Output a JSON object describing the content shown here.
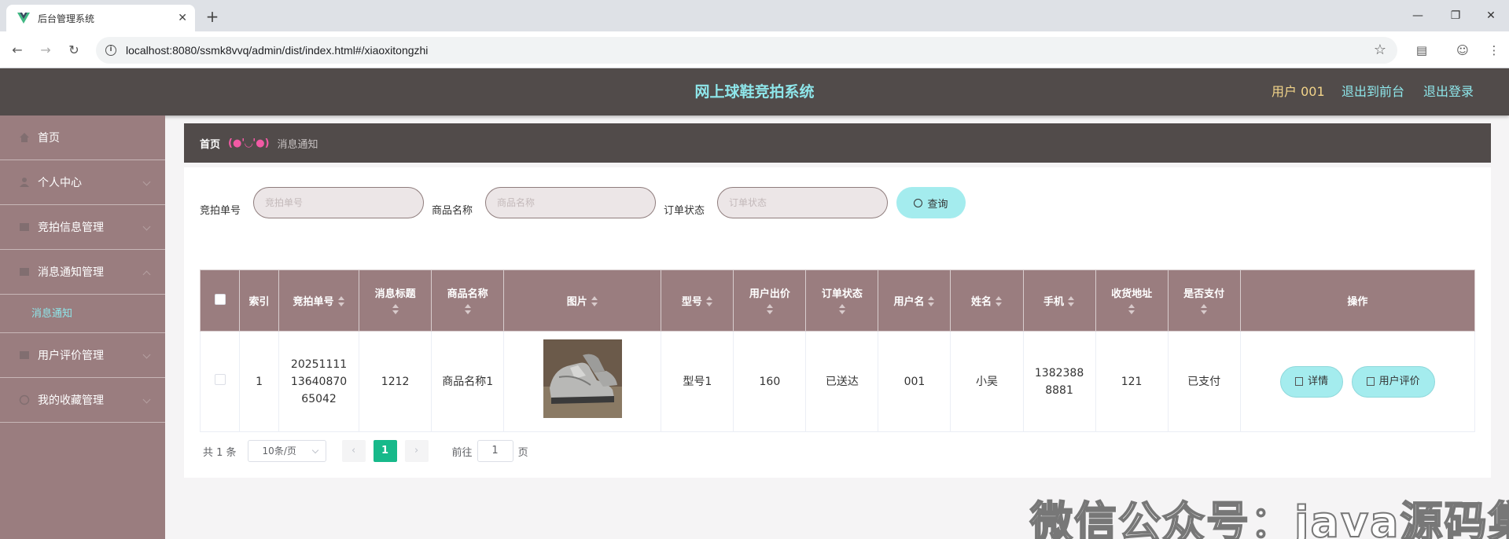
{
  "browser": {
    "tab_title": "后台管理系统",
    "tab_close": "✕",
    "new_tab": "+",
    "url": "localhost:8080/ssmk8vvq/admin/dist/index.html#/xiaoxitongzhi"
  },
  "header": {
    "title": "网上球鞋竞拍系统",
    "user": "用户 001",
    "to_front": "退出到前台",
    "logout": "退出登录"
  },
  "sidebar": {
    "items": [
      {
        "label": "首页"
      },
      {
        "label": "个人中心"
      },
      {
        "label": "竞拍信息管理"
      },
      {
        "label": "消息通知管理"
      },
      {
        "label": "消息通知"
      },
      {
        "label": "用户评价管理"
      },
      {
        "label": "我的收藏管理"
      }
    ]
  },
  "breadcrumb": {
    "home": "首页",
    "separator": "(●'◡'●)",
    "current": "消息通知"
  },
  "search": {
    "fields": [
      {
        "label": "竞拍单号",
        "placeholder": "竞拍单号"
      },
      {
        "label": "商品名称",
        "placeholder": "商品名称"
      },
      {
        "label": "订单状态",
        "placeholder": "订单状态"
      }
    ],
    "button": "查询"
  },
  "table": {
    "headers": [
      "索引",
      "竞拍单号",
      "消息标题",
      "商品名称",
      "图片",
      "型号",
      "用户出价",
      "订单状态",
      "用户名",
      "姓名",
      "手机",
      "收货地址",
      "是否支付",
      "操作"
    ],
    "rows": [
      {
        "index": "1",
        "auction_no": "202511111364087065042",
        "title": "1212",
        "product": "商品名称1",
        "model": "型号1",
        "bid": "160",
        "status": "已送达",
        "username": "001",
        "name": "小吴",
        "phone": "13823888881",
        "address": "121",
        "paid": "已支付",
        "actions": [
          "详情",
          "用户评价"
        ]
      }
    ]
  },
  "pagination": {
    "total": "共 1 条",
    "page_size": "10条/页",
    "current_page": "1",
    "goto_prefix": "前往",
    "goto_value": "1",
    "goto_suffix": "页"
  },
  "watermark": "微信公众号：java源码集合",
  "colors": {
    "header_bg": "#514b4a",
    "sidebar_bg": "#9a7d7f",
    "accent_cyan": "#8ee6ea",
    "button_bg": "#a4ecee",
    "page_active": "#17b98a"
  }
}
